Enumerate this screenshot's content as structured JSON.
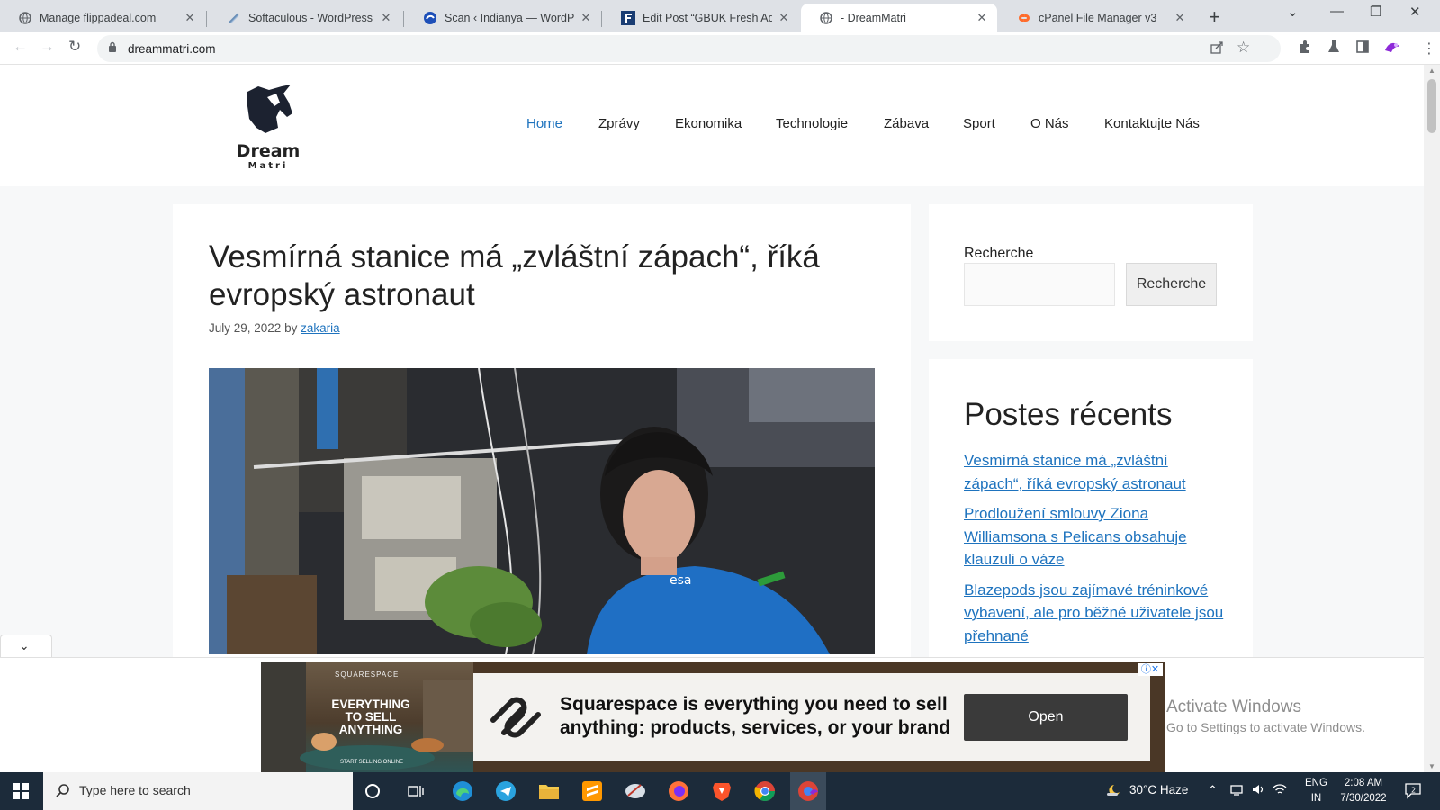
{
  "browser": {
    "tabs": [
      {
        "title": "Manage flippadeal.com",
        "icon": "globe-icon"
      },
      {
        "title": "Softaculous - WordPress Man",
        "icon": "softaculous-icon"
      },
      {
        "title": "Scan ‹ Indianya — WordPress",
        "icon": "wordfence-icon"
      },
      {
        "title": "Edit Post “GBUK Fresh Adsens",
        "icon": "f-icon"
      },
      {
        "title": "- DreamMatri",
        "icon": "globe-icon"
      },
      {
        "title": "cPanel File Manager v3",
        "icon": "cpanel-icon"
      }
    ],
    "active_tab": 4,
    "url": "dreammatri.com"
  },
  "site": {
    "logo": {
      "line1": "Dream",
      "line2": "Matri"
    },
    "nav": [
      "Home",
      "Zprávy",
      "Ekonomika",
      "Technologie",
      "Zábava",
      "Sport",
      "O Nás",
      "Kontaktujte Nás"
    ],
    "active_nav": "Home",
    "accent_color": "#1e73be"
  },
  "article": {
    "title": "Vesmírná stanice má „zvláštní zápach“, říká evropský astronaut",
    "date": "July 29, 2022",
    "by": "by",
    "author": "zakaria",
    "image_badge": "esa"
  },
  "sidebar": {
    "search": {
      "label": "Recherche",
      "button": "Recherche"
    },
    "recent": {
      "heading": "Postes récents",
      "posts": [
        "Vesmírná stanice má „zvláštní zápach“, říká evropský astronaut",
        "Prodloužení smlouvy Ziona Williamsona s Pelicans obsahuje klauzuli o váze",
        "Blazepods jsou zajímavé tréninkové vybavení, ale pro běžné uživatele jsou přehnané"
      ]
    }
  },
  "ad": {
    "image_brand": "SQUARESPACE",
    "image_headline": "EVERYTHING TO SELL ANYTHING",
    "image_small": "START SELLING ONLINE",
    "line1": "Squarespace is everything you need to sell",
    "line2": "anything: products, services, or your brand",
    "button": "Open"
  },
  "watermark": {
    "line1": "Activate Windows",
    "line2": "Go to Settings to activate Windows."
  },
  "taskbar": {
    "search_placeholder": "Type here to search",
    "weather": "30°C  Haze",
    "lang1": "ENG",
    "lang2": "IN",
    "time": "2:08 AM",
    "date": "7/30/2022",
    "notifications": "2"
  }
}
